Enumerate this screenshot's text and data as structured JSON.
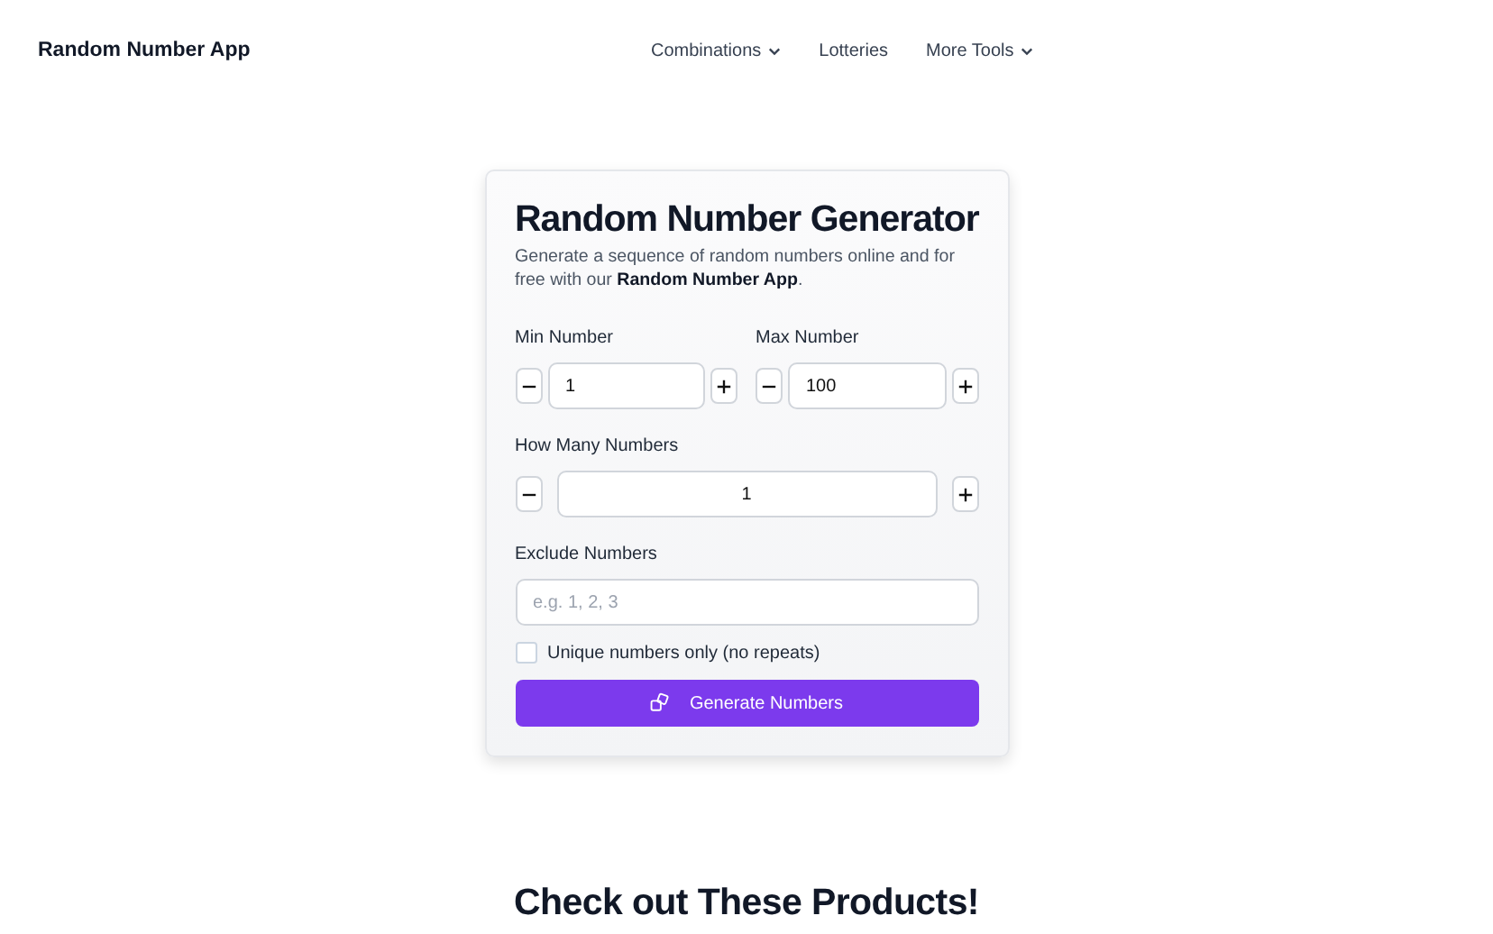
{
  "header": {
    "logo": "Random Number App",
    "nav": [
      {
        "label": "Combinations",
        "dropdown": true
      },
      {
        "label": "Lotteries",
        "dropdown": false
      },
      {
        "label": "More Tools",
        "dropdown": true
      }
    ]
  },
  "generator": {
    "title": "Random Number Generator",
    "description": "Generate a sequence of random numbers online and for free with our **Random Number App**.",
    "range_fields": [
      {
        "label": "Min Number",
        "value": "1"
      },
      {
        "label": "Max Number",
        "value": "100"
      }
    ],
    "count_field": {
      "label": "How Many Numbers",
      "value": "1"
    },
    "exclude_field": {
      "label": "Exclude Numbers",
      "placeholder": "e.g. 1, 2, 3"
    },
    "unique_checkbox": {
      "label": "Unique numbers only (no repeats)",
      "checked": false
    },
    "generate_button": "Generate Numbers"
  },
  "products_heading": "Check out These Products!"
}
